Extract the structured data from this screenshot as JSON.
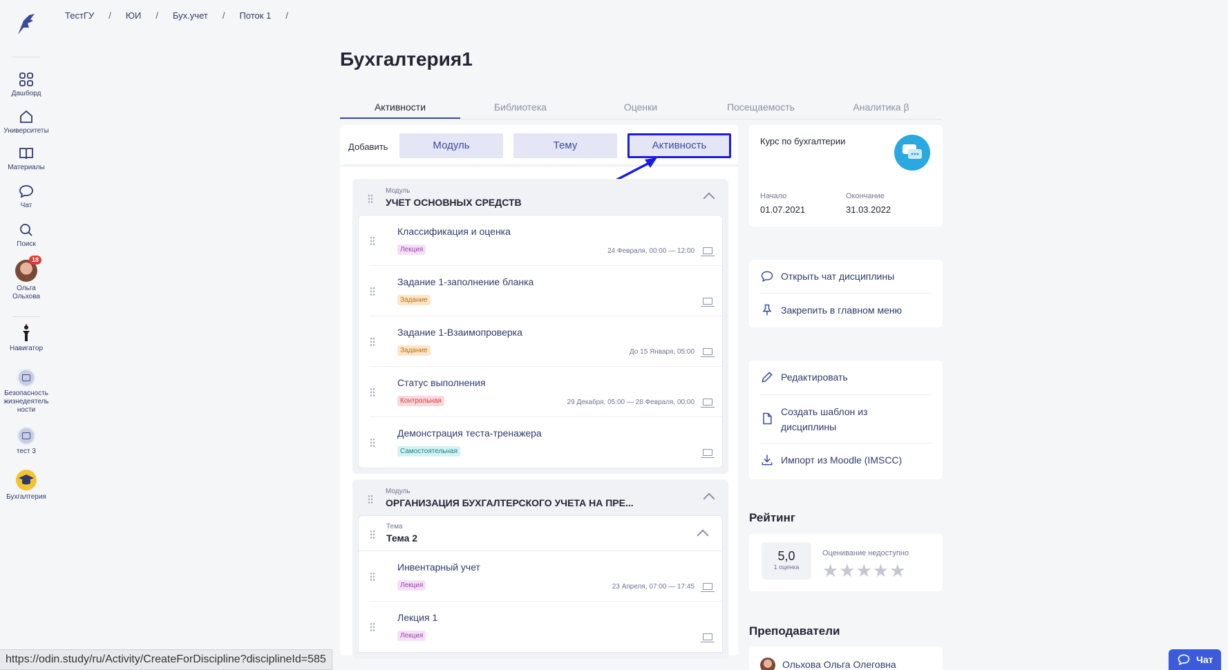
{
  "breadcrumb": [
    "ТестГУ",
    "ЮИ",
    "Бух.учет",
    "Поток 1"
  ],
  "breadcrumb_sep": "/",
  "page_title": "Бухгалтерия1",
  "tabs": [
    {
      "label": "Активности",
      "active": true
    },
    {
      "label": "Библиотека"
    },
    {
      "label": "Оценки"
    },
    {
      "label": "Посещаемость"
    },
    {
      "label": "Аналитика β"
    }
  ],
  "rail": {
    "dashboard": "Дашборд",
    "universities": "Университеты",
    "materials": "Материалы",
    "chat": "Чат",
    "search": "Поиск",
    "user_name": "Ольга Ольхова",
    "user_badge": "18",
    "navigator": "Навигатор",
    "course1": "Безопасность жизнедеятель ности",
    "course2": "тест 3",
    "course3": "Бухгалтерия"
  },
  "add_bar": {
    "label": "Добавить",
    "module": "Модуль",
    "topic": "Тему",
    "activity": "Активность"
  },
  "modules": [
    {
      "kicker": "Модуль",
      "name": "УЧЕТ ОСНОВНЫХ СРЕДСТВ",
      "items": [
        {
          "name": "Классификация и оценка",
          "tag": "Лекция",
          "when": "24 Февраля, 00:00 — 12:00"
        },
        {
          "name": "Задание 1-заполнение бланка",
          "tag": "Задание",
          "when": ""
        },
        {
          "name": "Задание 1-Взаимопроверка",
          "tag": "Задание",
          "when": "До 15 Января, 05:00"
        },
        {
          "name": "Статус выполнения",
          "tag": "Контрольная",
          "when": "29 Декабря, 05:00 — 28 Февраля, 00:00"
        },
        {
          "name": "Демонстрация теста-тренажера",
          "tag": "Самостоятельная",
          "when": ""
        }
      ]
    },
    {
      "kicker": "Модуль",
      "name": "ОРГАНИЗАЦИЯ БУХГАЛТЕРСКОГО УЧЕТА НА ПРЕ...",
      "topic": {
        "kicker": "Тема",
        "name": "Тема 2"
      },
      "items": [
        {
          "name": "Инвентарный учет",
          "tag": "Лекция",
          "when": "23 Апреля, 07:00 — 17:45"
        },
        {
          "name": "Лекция 1",
          "tag": "Лекция",
          "when": ""
        }
      ]
    }
  ],
  "course_card": {
    "title": "Курс по бухгалтерии",
    "start_label": "Начало",
    "start": "01.07.2021",
    "end_label": "Окончание",
    "end": "31.03.2022"
  },
  "actions1": {
    "open_chat": "Открыть чат дисциплины",
    "pin": "Закрепить в главном меню"
  },
  "actions2": {
    "edit": "Редактировать",
    "template": "Создать шаблон из дисциплины",
    "import": "Импорт из Moodle (IMSCC)"
  },
  "rating": {
    "heading": "Рейтинг",
    "score": "5,0",
    "count": "1 оценка",
    "label": "Оценивание недоступно",
    "stars": "★★★★★"
  },
  "teachers": {
    "heading": "Преподаватели",
    "name": "Ольхова Ольга Олеговна"
  },
  "status_url": "https://odin.study/ru/Activity/CreateForDiscipline?disciplineId=585",
  "chat_button": "Чат",
  "colors": {
    "accent": "#3b4aa0",
    "highlight": "#1a1ae6"
  }
}
